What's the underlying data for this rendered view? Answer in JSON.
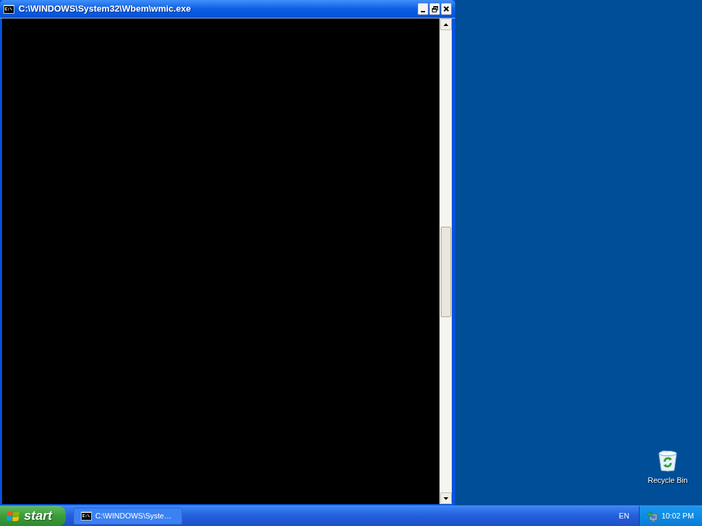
{
  "window": {
    "title": "C:\\WINDOWS\\System32\\Wbem\\wmic.exe"
  },
  "desktop_icons": [
    {
      "label": "Recycle Bin"
    }
  ],
  "taskbar": {
    "start_label": "start",
    "tasks": [
      {
        "label": "C:\\WINDOWS\\Syste…",
        "selected": false
      }
    ],
    "language": "EN",
    "clock": "10:02 PM"
  }
}
